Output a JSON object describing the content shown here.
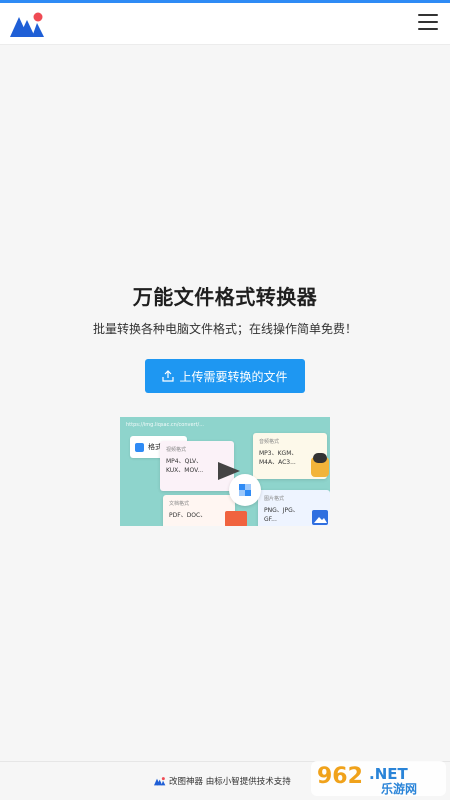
{
  "header": {
    "logo": "brand-logo",
    "menu_icon": "hamburger-menu-icon"
  },
  "main": {
    "title": "万能文件格式转换器",
    "subtitle": "批量转换各种电脑文件格式；在线操作简单免费！",
    "upload_button": {
      "label": "上传需要转换的文件",
      "icon": "upload-icon"
    }
  },
  "banner": {
    "url": "https://img.liqsac.cn/convert/...",
    "tag_label": "格式转换",
    "cards": [
      {
        "title": "视频格式",
        "lines": [
          "MP4、QLV、",
          "KUX、MOV..."
        ]
      },
      {
        "title": "音频格式",
        "lines": [
          "MP3、KGM、",
          "M4A、AC3..."
        ]
      },
      {
        "title": "文档格式",
        "lines": [
          "PDF、DOC、"
        ]
      },
      {
        "title": "图片格式",
        "lines": [
          "PNG、JPG、",
          "GF..."
        ]
      }
    ]
  },
  "footer": {
    "text": "改图神器 由标小智提供技术支持"
  },
  "watermark": {
    "number": "962",
    "suffix": ".NET",
    "cn": "乐游网"
  },
  "colors": {
    "accent": "#1e97f2",
    "topline": "#2f8bf5",
    "logo_dot": "#ef4b54",
    "logo_blue": "#1f5fd6"
  }
}
